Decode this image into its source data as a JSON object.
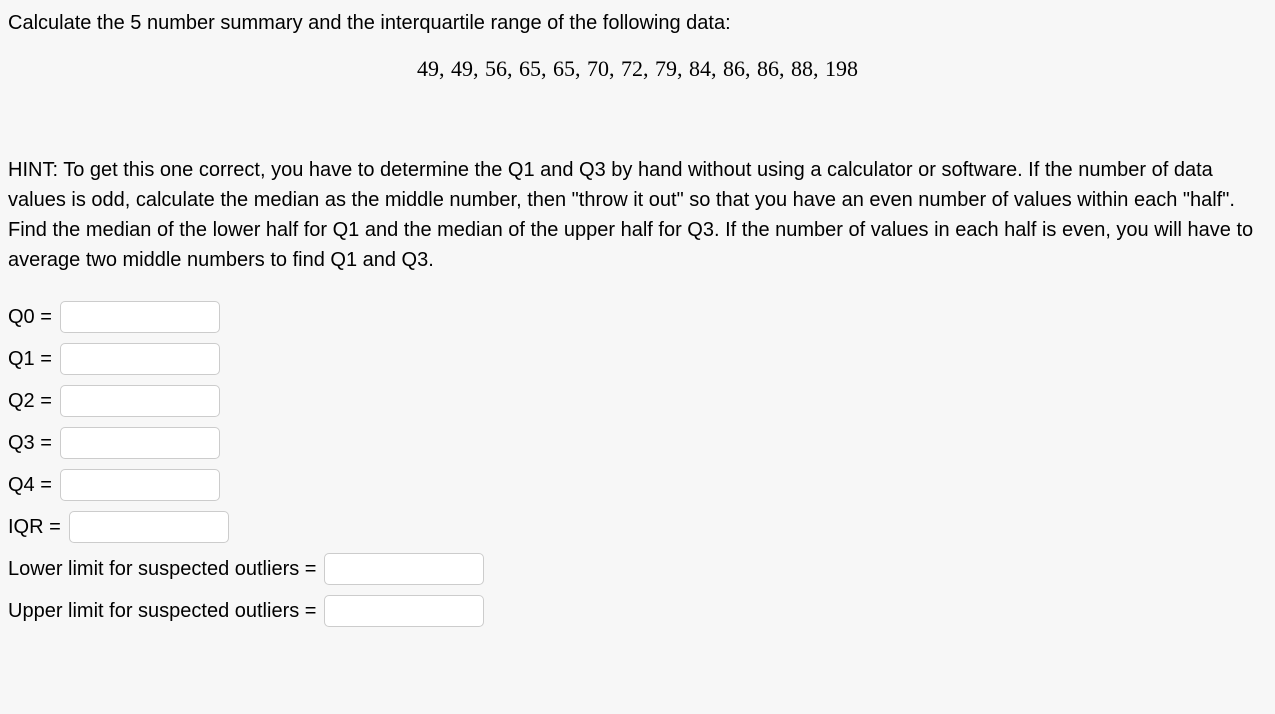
{
  "question": {
    "prompt": "Calculate the 5 number summary and the interquartile range of the following data:",
    "data_values": "49,  49,  56,  65,  65,  70,  72,  79,  84,  86,  86,  88,  198",
    "hint": "HINT: To get this one correct, you have to determine the Q1 and Q3 by hand without using a calculator or software. If the number of data values is odd, calculate the median as the middle number, then \"throw it out\" so that you have an even number of values within each \"half\". Find the median of the lower half for Q1 and the median of the upper half for Q3. If the number of values in each half is even, you will have to average two middle numbers to find Q1 and Q3."
  },
  "answers": {
    "q0": {
      "label": "Q0 =",
      "value": ""
    },
    "q1": {
      "label": "Q1 =",
      "value": ""
    },
    "q2": {
      "label": "Q2 =",
      "value": ""
    },
    "q3": {
      "label": "Q3 =",
      "value": ""
    },
    "q4": {
      "label": "Q4 =",
      "value": ""
    },
    "iqr": {
      "label": "IQR =",
      "value": ""
    },
    "lower_limit": {
      "label": "Lower limit for suspected outliers =",
      "value": ""
    },
    "upper_limit": {
      "label": "Upper limit for suspected outliers =",
      "value": ""
    }
  }
}
